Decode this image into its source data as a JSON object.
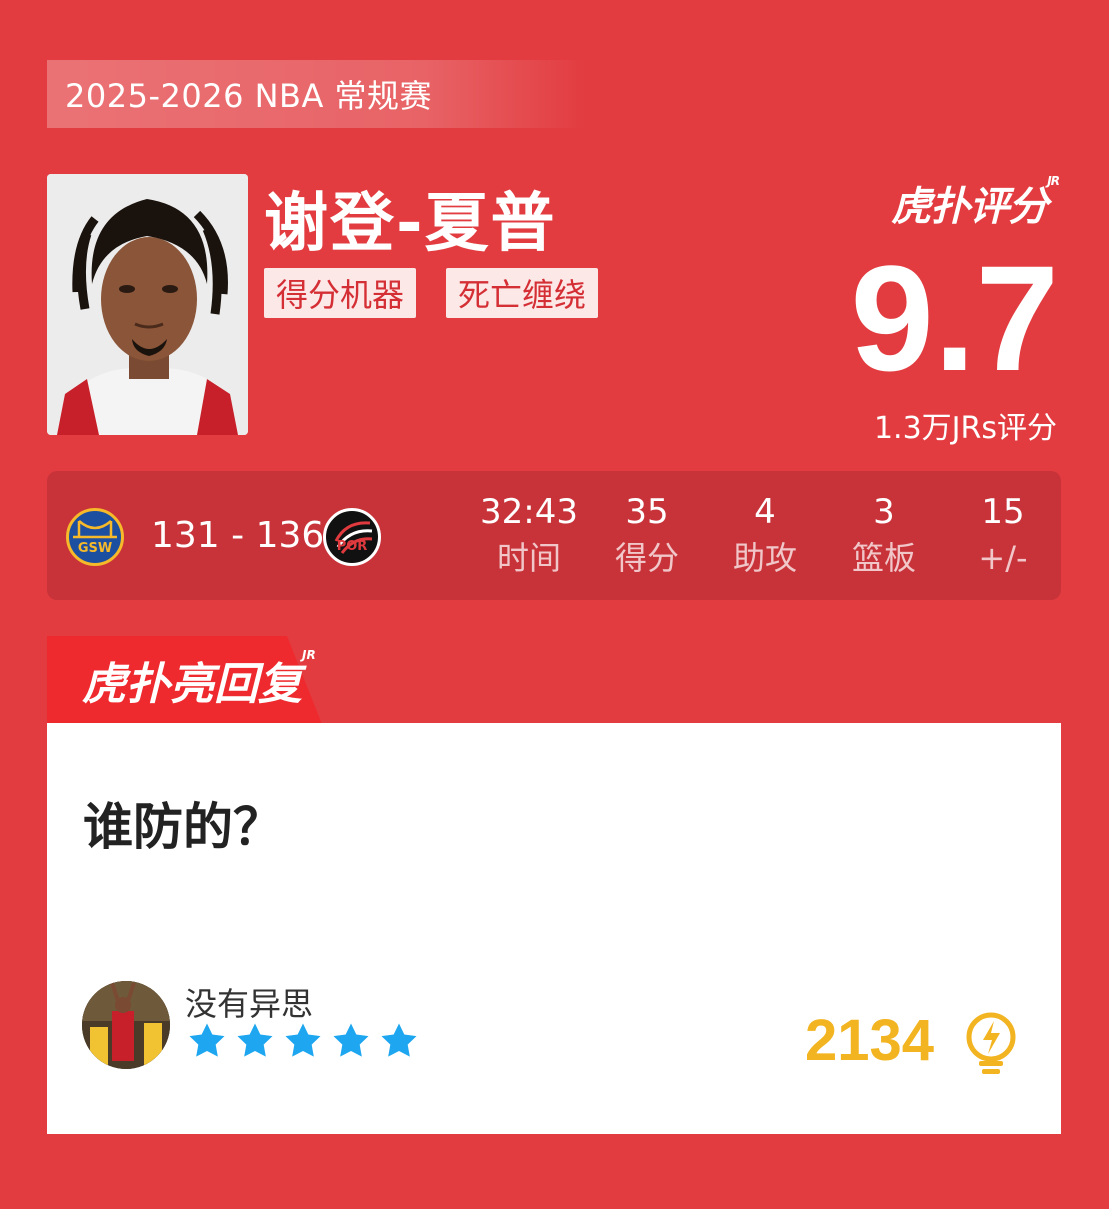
{
  "season": "2025-2026 NBA 常规赛",
  "player": {
    "name": "谢登-夏普",
    "tags": [
      "得分机器",
      "死亡缠绕"
    ]
  },
  "rating": {
    "brand": "虎扑评分",
    "brand_mark": "JR",
    "score": "9.7",
    "count_text": "1.3万JRs评分"
  },
  "game": {
    "home_team": "GSW",
    "away_team": "POR",
    "score": "131 - 136",
    "stats": [
      {
        "value": "32:43",
        "label": "时间"
      },
      {
        "value": "35",
        "label": "得分"
      },
      {
        "value": "4",
        "label": "助攻"
      },
      {
        "value": "3",
        "label": "篮板"
      },
      {
        "value": "15",
        "label": "+/-"
      }
    ]
  },
  "reply": {
    "banner": "虎扑亮回复",
    "banner_mark": "JR",
    "comment": "谁防的？",
    "user": "没有异思",
    "stars": 5,
    "likes": "2134"
  },
  "colors": {
    "background": "#e23c40",
    "stats_bg": "#c8333a",
    "tag_text": "#d42f35",
    "star": "#1ea7f0",
    "likes": "#f3b421"
  }
}
